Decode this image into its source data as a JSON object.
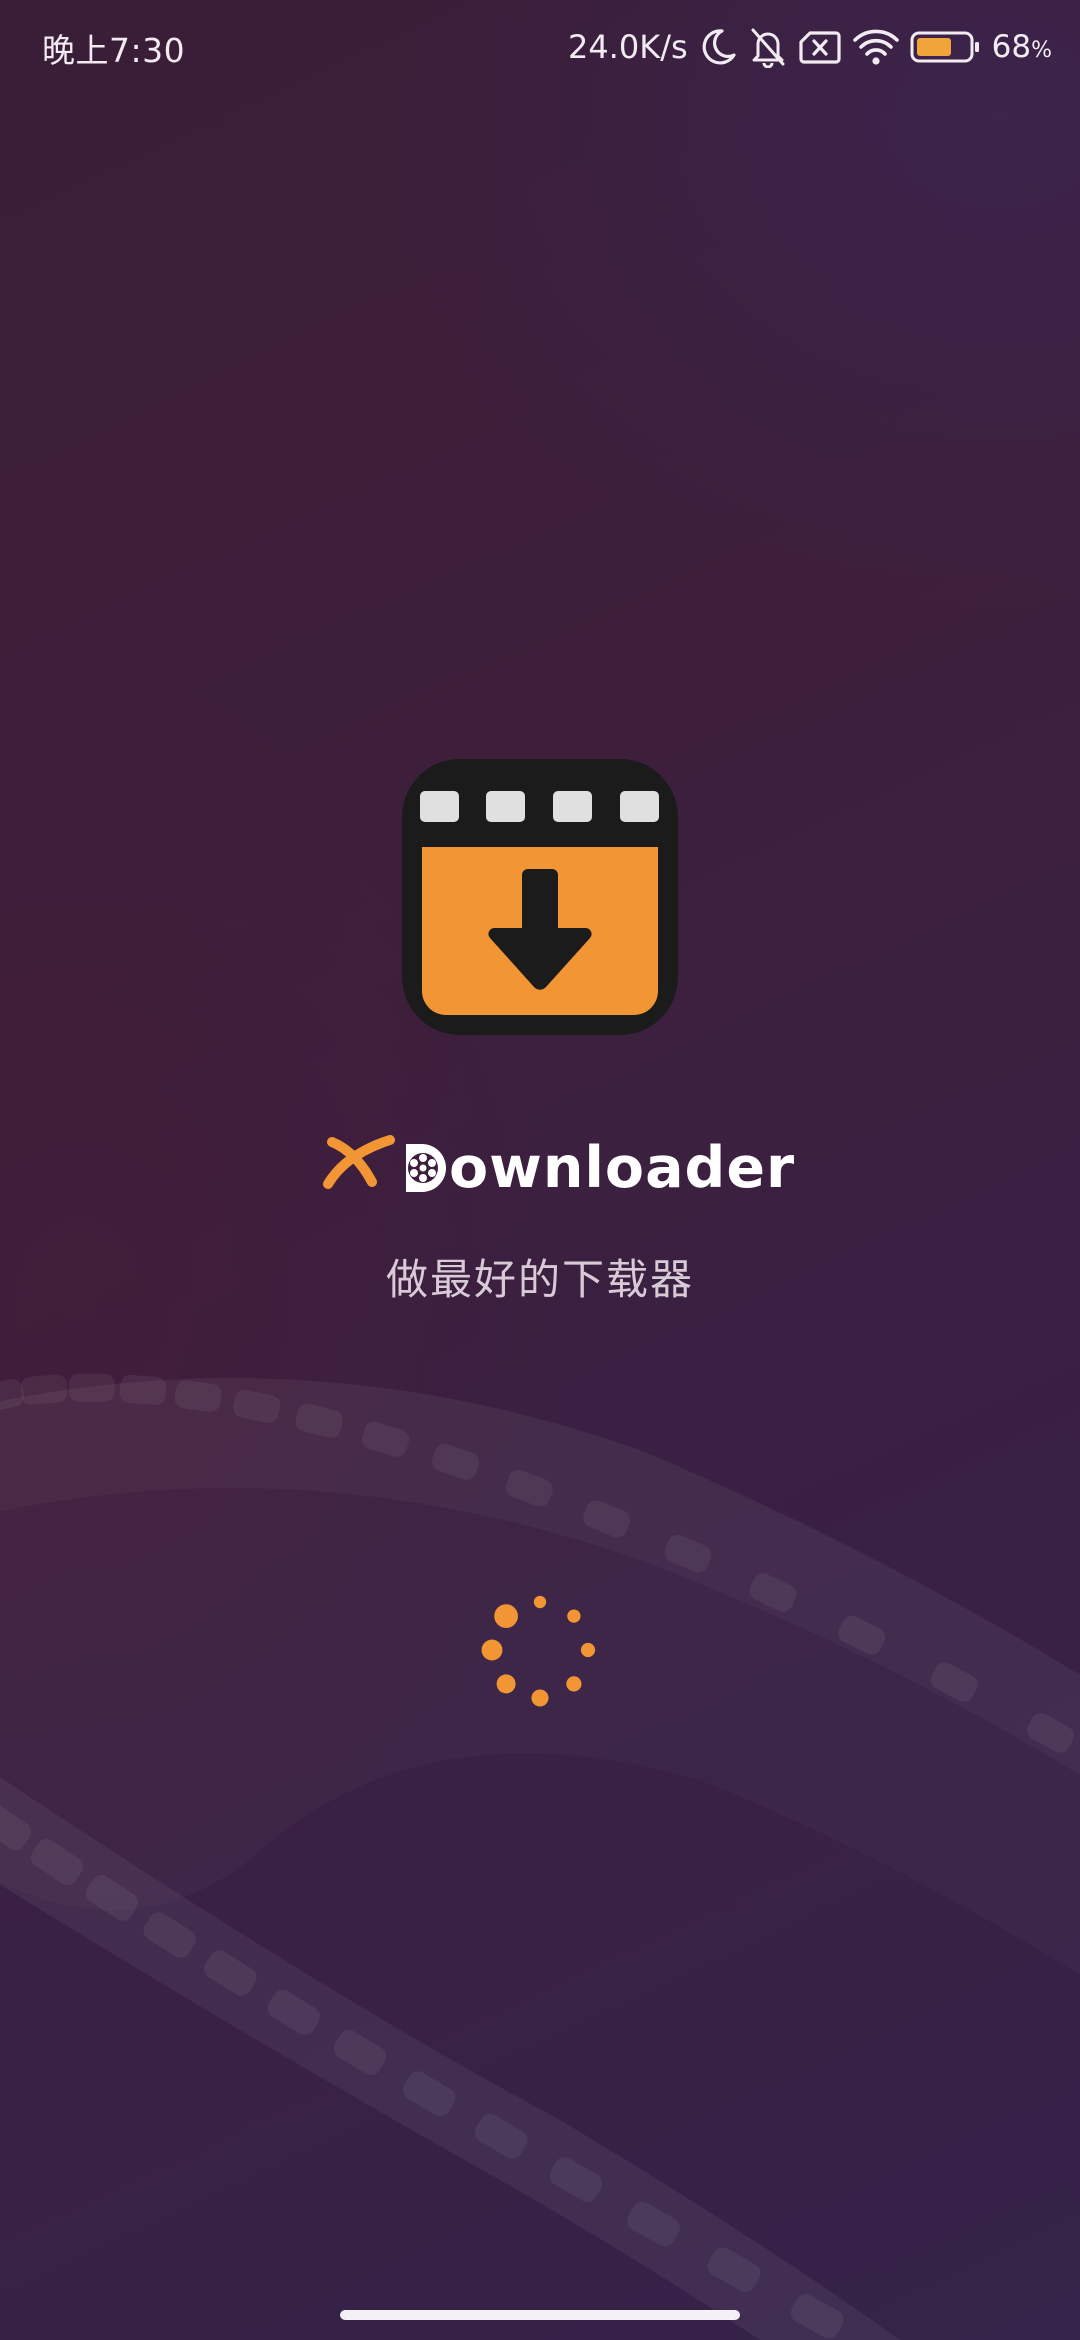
{
  "status_bar": {
    "time": "晚上7:30",
    "net_speed": "24.0K/s",
    "battery_percent": "68",
    "battery_percent_unit": "%",
    "battery_level": 0.68,
    "icons": [
      "moon-icon",
      "bell-muted-icon",
      "sim-disabled-icon",
      "wifi-icon",
      "battery-icon"
    ]
  },
  "splash": {
    "brand_prefix_mark": "X",
    "brand_first_letter": "D",
    "brand_rest": "ownloader",
    "tagline": "做最好的下载器"
  },
  "colors": {
    "accent": "#f29534",
    "icon_dark": "#1b1b1b",
    "perforation": "#e0e0e0",
    "text_primary": "#ffffff",
    "text_secondary": "#d8cbd7"
  }
}
